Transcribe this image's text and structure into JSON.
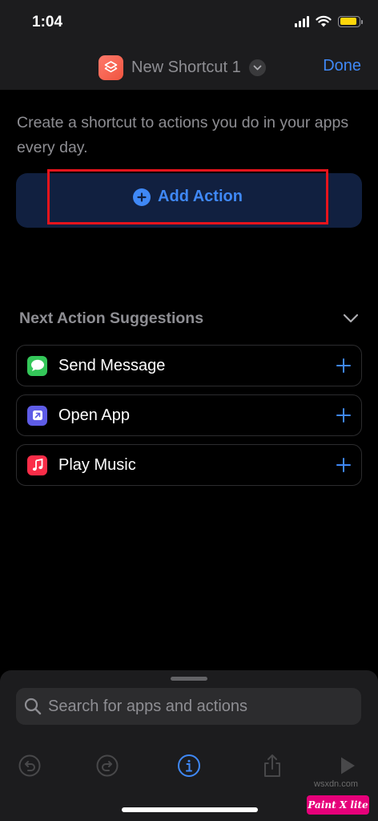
{
  "status_bar": {
    "time": "1:04",
    "battery_level": 0.9,
    "battery_color": "#ffd60a"
  },
  "nav": {
    "title": "New Shortcut 1",
    "done_label": "Done",
    "app_icon": "shortcuts-icon",
    "accent_color": "#3f88f6"
  },
  "main": {
    "intro": "Create a shortcut to actions you do in your apps every day.",
    "add_action_label": "Add Action",
    "highlight_color": "#e8141c"
  },
  "suggestions": {
    "title": "Next Action Suggestions",
    "items": [
      {
        "label": "Send Message",
        "icon": "messages-icon",
        "icon_color": "#34c759"
      },
      {
        "label": "Open App",
        "icon": "open-app-icon",
        "icon_color": "#5e5ce6"
      },
      {
        "label": "Play Music",
        "icon": "music-icon",
        "icon_color": "#fa2d48"
      }
    ]
  },
  "search": {
    "placeholder": "Search for apps and actions"
  },
  "toolbar": {
    "buttons": [
      "undo-icon",
      "redo-icon",
      "info-icon",
      "share-icon",
      "play-icon"
    ]
  },
  "watermark": {
    "label": "Paint X lite",
    "url": "wsxdn.com"
  }
}
